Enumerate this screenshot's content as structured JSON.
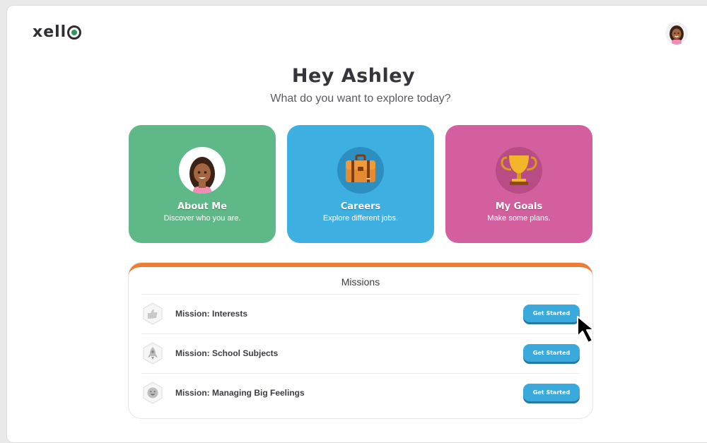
{
  "app": {
    "logo_text": "xell"
  },
  "greeting": {
    "title": "Hey Ashley",
    "subtitle": "What do you want to explore today?"
  },
  "cards": [
    {
      "title": "About Me",
      "subtitle": "Discover who you are.",
      "color": "#5fb887",
      "icon": "girl-avatar-icon"
    },
    {
      "title": "Careers",
      "subtitle": "Explore different jobs.",
      "color": "#3dafe0",
      "icon": "briefcase-icon"
    },
    {
      "title": "My Goals",
      "subtitle": "Make some plans.",
      "color": "#d45f9e",
      "icon": "trophy-icon"
    }
  ],
  "missions": {
    "heading": "Missions",
    "accent_color": "#ee7d34",
    "items": [
      {
        "label": "Mission: Interests",
        "button": "Get Started",
        "icon": "thumbs-up-icon"
      },
      {
        "label": "Mission: School Subjects",
        "button": "Get Started",
        "icon": "rocket-icon"
      },
      {
        "label": "Mission: Managing Big Feelings",
        "button": "Get Started",
        "icon": "smiley-icon"
      }
    ]
  }
}
